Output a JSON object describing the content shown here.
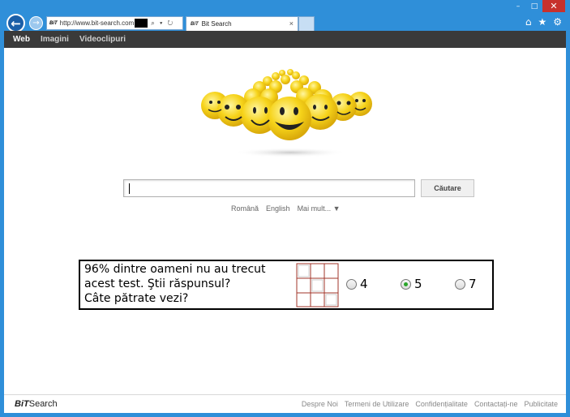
{
  "browser": {
    "address_url": "http://www.bit-search.com",
    "tab_title": "Bit Search",
    "tab_close": "×",
    "favicon_text": "BiT",
    "minimize": "–",
    "maximize": "□",
    "close": "✕",
    "address_tools": "⌕ ▾ ↻",
    "home_icon": "⌂",
    "star_icon": "★",
    "gear_icon": "⚙",
    "back_icon": "←",
    "forward_icon": "→"
  },
  "nav": {
    "items": [
      {
        "label": "Web",
        "active": true
      },
      {
        "label": "Imagini",
        "active": false
      },
      {
        "label": "Videoclipuri",
        "active": false
      }
    ]
  },
  "search": {
    "input_value": "",
    "button_label": "Căutare"
  },
  "languages": {
    "items": [
      "Română",
      "English",
      "Mai mult... ▼"
    ]
  },
  "ad": {
    "line1": "96% dintre oameni nu au trecut",
    "line2": "acest test. Ştii răspunsul?",
    "line3": "Câte pătrate vezi?",
    "options": [
      {
        "label": "4",
        "selected": false
      },
      {
        "label": "5",
        "selected": true
      },
      {
        "label": "7",
        "selected": false
      }
    ]
  },
  "footer": {
    "logo_bit": "BiT",
    "logo_search": "Search",
    "links": [
      "Despre Noi",
      "Termeni de Utilizare",
      "Confidențialitate",
      "Contactați-ne",
      "Publicitate"
    ]
  },
  "colors": {
    "frame_blue": "#2f8fd9",
    "nav_dark": "#3a3a3a",
    "smiley_yellow": "#f6d31a",
    "radio_green": "#2aa52a",
    "grid_red": "#a0342a"
  }
}
